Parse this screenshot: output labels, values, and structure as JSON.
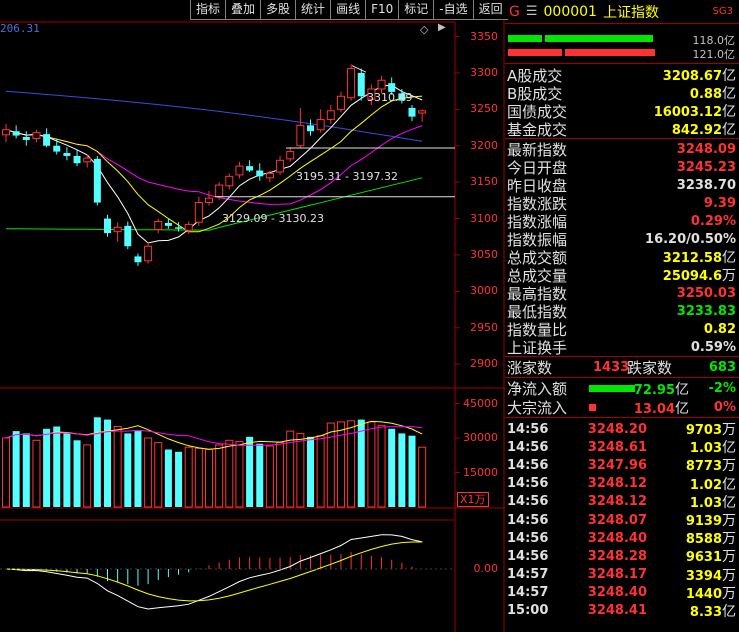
{
  "toolbar": {
    "buttons": [
      "指标",
      "叠加",
      "多股",
      "统计",
      "画线",
      "F10",
      "标记",
      "-自选",
      "返回"
    ]
  },
  "chart": {
    "corner_value": "206.31",
    "price_axis": [
      "3350",
      "3300",
      "3250",
      "3200",
      "3150",
      "3100",
      "3050",
      "3000",
      "2950",
      "2900"
    ],
    "volume_axis": [
      "45000",
      "30000",
      "15000"
    ],
    "volume_unit": "X1万",
    "macd_axis": [
      "0.00"
    ],
    "annotations": {
      "high": "3310.49",
      "mid": "3195.31 - 3197.32",
      "low": "3129.09 - 3130.23"
    },
    "colors": {
      "up": "#ff3232",
      "down": "#54ffff",
      "ma5": "#ffffff",
      "ma10": "#ffff00",
      "ma20": "#ff00ff",
      "ma60": "#00e600",
      "ma_long": "#3a4ce0",
      "grid": "#a00000"
    }
  },
  "chart_data": {
    "type": "candlestick",
    "ylim": [
      2870,
      3370
    ],
    "candles": [
      {
        "o": 3215,
        "h": 3230,
        "l": 3205,
        "c": 3222
      },
      {
        "o": 3220,
        "h": 3228,
        "l": 3210,
        "c": 3214
      },
      {
        "o": 3212,
        "h": 3220,
        "l": 3200,
        "c": 3208
      },
      {
        "o": 3210,
        "h": 3222,
        "l": 3205,
        "c": 3218
      },
      {
        "o": 3216,
        "h": 3224,
        "l": 3198,
        "c": 3200
      },
      {
        "o": 3200,
        "h": 3210,
        "l": 3188,
        "c": 3192
      },
      {
        "o": 3190,
        "h": 3198,
        "l": 3180,
        "c": 3186
      },
      {
        "o": 3186,
        "h": 3195,
        "l": 3172,
        "c": 3176
      },
      {
        "o": 3178,
        "h": 3188,
        "l": 3170,
        "c": 3183
      },
      {
        "o": 3182,
        "h": 3186,
        "l": 3118,
        "c": 3122
      },
      {
        "o": 3100,
        "h": 3105,
        "l": 3075,
        "c": 3080
      },
      {
        "o": 3082,
        "h": 3095,
        "l": 3068,
        "c": 3088
      },
      {
        "o": 3090,
        "h": 3096,
        "l": 3058,
        "c": 3062
      },
      {
        "o": 3048,
        "h": 3052,
        "l": 3035,
        "c": 3040
      },
      {
        "o": 3042,
        "h": 3068,
        "l": 3038,
        "c": 3062
      },
      {
        "o": 3085,
        "h": 3100,
        "l": 3080,
        "c": 3096
      },
      {
        "o": 3094,
        "h": 3100,
        "l": 3086,
        "c": 3090
      },
      {
        "o": 3088,
        "h": 3095,
        "l": 3082,
        "c": 3086
      },
      {
        "o": 3084,
        "h": 3096,
        "l": 3079,
        "c": 3092
      },
      {
        "o": 3095,
        "h": 3130,
        "l": 3090,
        "c": 3122
      },
      {
        "o": 3122,
        "h": 3138,
        "l": 3118,
        "c": 3128
      },
      {
        "o": 3130,
        "h": 3150,
        "l": 3126,
        "c": 3146
      },
      {
        "o": 3145,
        "h": 3162,
        "l": 3140,
        "c": 3158
      },
      {
        "o": 3160,
        "h": 3178,
        "l": 3155,
        "c": 3172
      },
      {
        "o": 3172,
        "h": 3180,
        "l": 3164,
        "c": 3166
      },
      {
        "o": 3166,
        "h": 3176,
        "l": 3152,
        "c": 3158
      },
      {
        "o": 3156,
        "h": 3166,
        "l": 3150,
        "c": 3162
      },
      {
        "o": 3164,
        "h": 3186,
        "l": 3160,
        "c": 3180
      },
      {
        "o": 3182,
        "h": 3198,
        "l": 3178,
        "c": 3192
      },
      {
        "o": 3200,
        "h": 3252,
        "l": 3196,
        "c": 3228
      },
      {
        "o": 3228,
        "h": 3236,
        "l": 3214,
        "c": 3220
      },
      {
        "o": 3222,
        "h": 3250,
        "l": 3218,
        "c": 3236
      },
      {
        "o": 3236,
        "h": 3256,
        "l": 3230,
        "c": 3248
      },
      {
        "o": 3250,
        "h": 3274,
        "l": 3246,
        "c": 3268
      },
      {
        "o": 3266,
        "h": 3312,
        "l": 3262,
        "c": 3306
      },
      {
        "o": 3300,
        "h": 3306,
        "l": 3262,
        "c": 3268
      },
      {
        "o": 3264,
        "h": 3284,
        "l": 3256,
        "c": 3278
      },
      {
        "o": 3278,
        "h": 3296,
        "l": 3272,
        "c": 3290
      },
      {
        "o": 3286,
        "h": 3294,
        "l": 3270,
        "c": 3274
      },
      {
        "o": 3272,
        "h": 3278,
        "l": 3258,
        "c": 3262
      },
      {
        "o": 3252,
        "h": 3256,
        "l": 3234,
        "c": 3240
      },
      {
        "o": 3245,
        "h": 3250,
        "l": 3233,
        "c": 3248
      }
    ],
    "volume": [
      30000,
      33000,
      32000,
      29000,
      34000,
      35000,
      32000,
      29000,
      27000,
      39000,
      38000,
      35000,
      32000,
      33000,
      30000,
      28000,
      25000,
      24000,
      26000,
      25500,
      25000,
      27000,
      29000,
      28500,
      30500,
      27500,
      26500,
      28000,
      33000,
      32000,
      30500,
      31000,
      36500,
      37000,
      37500,
      38000,
      37000,
      35500,
      34000,
      32000,
      31000,
      26000
    ]
  },
  "quote": {
    "g": "G",
    "menu_icon": "menu-icon",
    "code": "000001",
    "name": "上证指数",
    "badge": "SG3",
    "bar1_text": "118.0亿",
    "bar2_text": "121.0亿",
    "turnover": [
      {
        "label": "A股成交",
        "value": "3208.67",
        "unit": "亿"
      },
      {
        "label": "B股成交",
        "value": "0.88",
        "unit": "亿"
      },
      {
        "label": "国债成交",
        "value": "16003.12",
        "unit": "亿"
      },
      {
        "label": "基金成交",
        "value": "842.92",
        "unit": "亿"
      }
    ],
    "stats": [
      {
        "label": "最新指数",
        "value": "3248.09",
        "color": "red",
        "unit": ""
      },
      {
        "label": "今日开盘",
        "value": "3245.23",
        "color": "red",
        "unit": ""
      },
      {
        "label": "昨日收盘",
        "value": "3238.70",
        "color": "white",
        "unit": ""
      },
      {
        "label": "指数涨跌",
        "value": "9.39",
        "color": "red",
        "unit": ""
      },
      {
        "label": "指数涨幅",
        "value": "0.29%",
        "color": "red",
        "unit": ""
      },
      {
        "label": "指数振幅",
        "value": "16.20/0.50%",
        "color": "white",
        "unit": ""
      },
      {
        "label": "总成交额",
        "value": "3212.58",
        "color": "yellow",
        "unit": "亿"
      },
      {
        "label": "总成交量",
        "value": "25094.6",
        "color": "yellow",
        "unit": "万"
      },
      {
        "label": "最高指数",
        "value": "3250.03",
        "color": "red",
        "unit": ""
      },
      {
        "label": "最低指数",
        "value": "3233.83",
        "color": "green",
        "unit": ""
      },
      {
        "label": "指数量比",
        "value": "0.82",
        "color": "yellow",
        "unit": ""
      },
      {
        "label": "上证换手",
        "value": "0.59%",
        "color": "white",
        "unit": ""
      }
    ],
    "updown": {
      "up_label": "涨家数",
      "up_value": "1433",
      "down_label": "跌家数",
      "down_value": "683"
    },
    "flows": [
      {
        "label": "净流入额",
        "value": "-72.95",
        "unit": "亿",
        "pct": "-2%",
        "color": "green",
        "bar_color": "#00e600",
        "bar_fraction": 1.0
      },
      {
        "label": "大宗流入",
        "value": "13.04",
        "unit": "亿",
        "pct": "0%",
        "color": "red",
        "bar_color": "#ff3232",
        "bar_fraction": 0.15
      }
    ],
    "ticks": [
      {
        "t": "14:56",
        "p": "3248.20",
        "v": "9703",
        "unit": "万"
      },
      {
        "t": "14:56",
        "p": "3248.61",
        "v": "1.03",
        "unit": "亿"
      },
      {
        "t": "14:56",
        "p": "3247.96",
        "v": "8773",
        "unit": "万"
      },
      {
        "t": "14:56",
        "p": "3248.12",
        "v": "1.02",
        "unit": "亿"
      },
      {
        "t": "14:56",
        "p": "3248.12",
        "v": "1.03",
        "unit": "亿"
      },
      {
        "t": "14:56",
        "p": "3248.07",
        "v": "9139",
        "unit": "万"
      },
      {
        "t": "14:56",
        "p": "3248.40",
        "v": "8588",
        "unit": "万"
      },
      {
        "t": "14:56",
        "p": "3248.28",
        "v": "9631",
        "unit": "万"
      },
      {
        "t": "14:57",
        "p": "3248.17",
        "v": "3394",
        "unit": "万"
      },
      {
        "t": "14:57",
        "p": "3248.40",
        "v": "1440",
        "unit": "万"
      },
      {
        "t": "15:00",
        "p": "3248.41",
        "v": "8.33",
        "unit": "亿"
      }
    ]
  }
}
